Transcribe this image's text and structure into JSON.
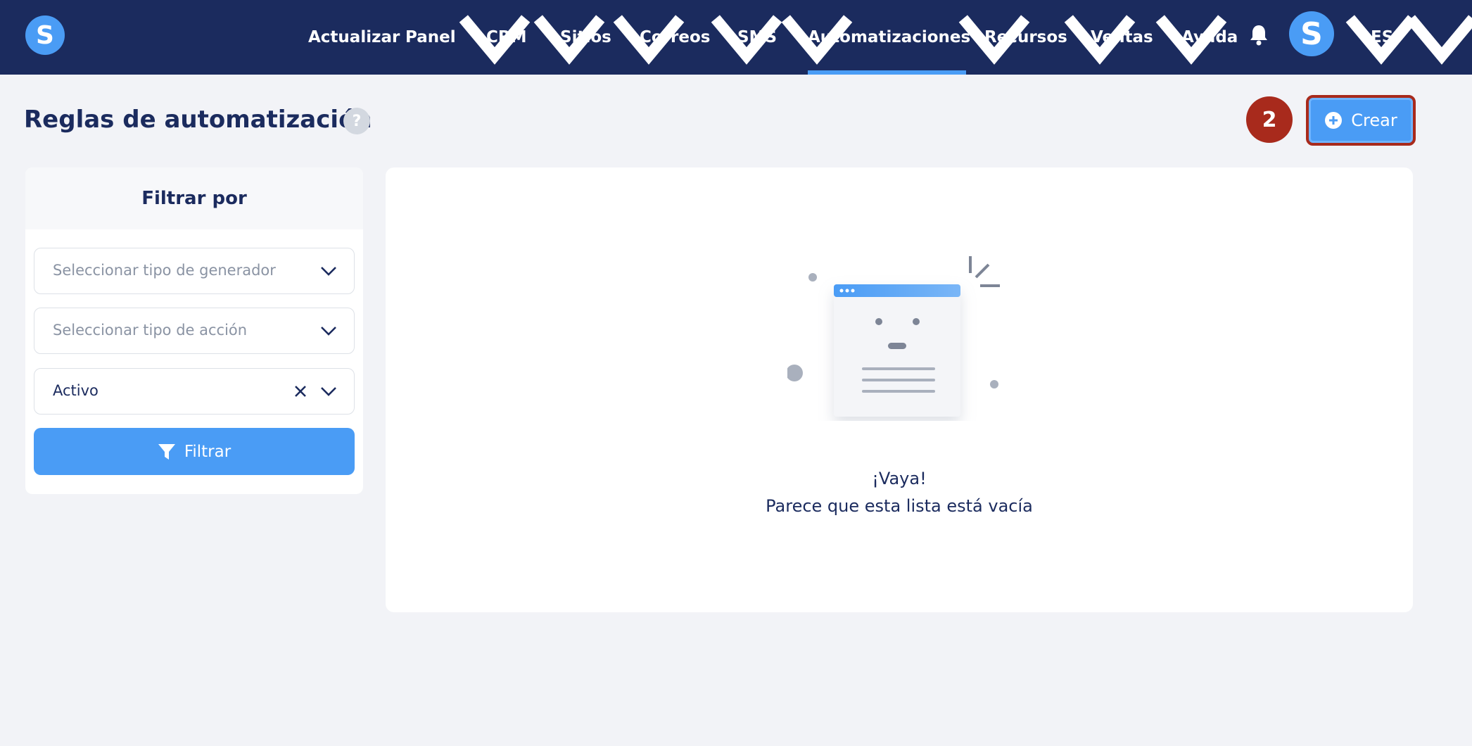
{
  "app": {
    "logo_letter": "S",
    "avatar_letter": "S"
  },
  "nav": {
    "items": [
      {
        "label": "Actualizar",
        "dropdown": false
      },
      {
        "label": "Panel",
        "dropdown": true
      },
      {
        "label": "CRM",
        "dropdown": true
      },
      {
        "label": "Sitios",
        "dropdown": true
      },
      {
        "label": "Correos",
        "dropdown": true
      },
      {
        "label": "SMS",
        "dropdown": true
      },
      {
        "label": "Automatizaciones",
        "dropdown": true,
        "active": true
      },
      {
        "label": "Recursos",
        "dropdown": true
      },
      {
        "label": "Ventas",
        "dropdown": true
      },
      {
        "label": "Ayuda",
        "dropdown": false
      }
    ],
    "language": "ES",
    "icons": {
      "notifications": "bell-icon"
    }
  },
  "header": {
    "title": "Reglas de automatización",
    "help": "?",
    "step_number": "2",
    "create_label": "Crear"
  },
  "filter": {
    "title": "Filtrar por",
    "generator_placeholder": "Seleccionar tipo de generador",
    "action_placeholder": "Seleccionar tipo de acción",
    "status_value": "Activo",
    "button_label": "Filtrar"
  },
  "empty_state": {
    "title": "¡Vaya!",
    "subtitle": "Parece que esta lista está vacía"
  },
  "colors": {
    "navbar": "#1b2b5e",
    "accent": "#4a9cf5",
    "highlight": "#a82a1c",
    "background": "#f2f3f7"
  }
}
